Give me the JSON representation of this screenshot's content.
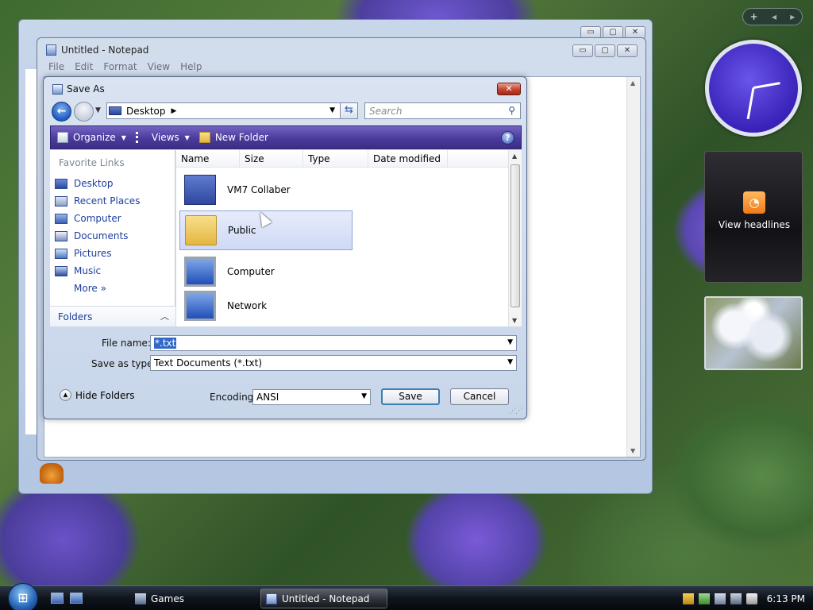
{
  "background_window": {
    "minimize": "▭",
    "maximize": "▢",
    "close": "✕"
  },
  "notepad": {
    "title": "Untitled - Notepad",
    "menu": [
      "File",
      "Edit",
      "Format",
      "View",
      "Help"
    ],
    "buttons": {
      "minimize": "▭",
      "maximize": "▢",
      "close": "✕"
    }
  },
  "save_dialog": {
    "title": "Save As",
    "close": "✕",
    "address": "Desktop",
    "search_placeholder": "Search",
    "toolbar": {
      "organize": "Organize",
      "views": "Views",
      "new_folder": "New Folder",
      "help": "?"
    },
    "favorite_links_title": "Favorite Links",
    "favorite_links": [
      "Desktop",
      "Recent Places",
      "Computer",
      "Documents",
      "Pictures",
      "Music",
      "More »"
    ],
    "folders_label": "Folders",
    "columns": [
      "Name",
      "Size",
      "Type",
      "Date modified"
    ],
    "files": [
      {
        "name": "VM7 Collaber",
        "icon": "user-folder-icon",
        "selected": false
      },
      {
        "name": "Public",
        "icon": "folder-icon",
        "selected": true
      },
      {
        "name": "Computer",
        "icon": "computer-icon",
        "selected": false
      },
      {
        "name": "Network",
        "icon": "network-icon",
        "selected": false
      }
    ],
    "file_name_label": "File name:",
    "file_name_value": "*.txt",
    "save_as_type_label": "Save as type:",
    "save_as_type_value": "Text Documents (*.txt)",
    "hide_folders": "Hide Folders",
    "encoding_label": "Encoding:",
    "encoding_value": "ANSI",
    "save_button": "Save",
    "cancel_button": "Cancel"
  },
  "sidebar": {
    "add": "+",
    "prev": "◂",
    "next": "▸",
    "feed_text": "View headlines"
  },
  "taskbar": {
    "items": [
      {
        "label": "Games",
        "active": false
      },
      {
        "label": "Untitled - Notepad",
        "active": true
      }
    ],
    "clock": "6:13 PM"
  },
  "colors": {
    "toolbar": "#4b3a9c",
    "clock_face": "#3822b8",
    "link": "#1d3fa0",
    "selection": "#3169c6"
  }
}
